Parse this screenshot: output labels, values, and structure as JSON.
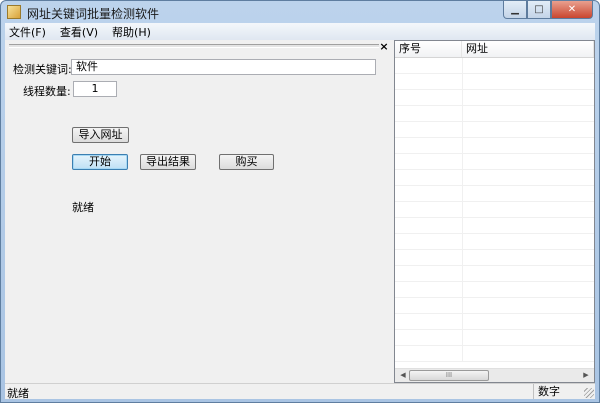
{
  "window": {
    "title": "网址关键词批量检测软件",
    "minimize_glyph": "▁",
    "maximize_glyph": "□",
    "close_glyph": "✕"
  },
  "menu": {
    "items": [
      "文件(F)",
      "查看(V)",
      "帮助(H)"
    ]
  },
  "panel": {
    "close_glyph": "×"
  },
  "form": {
    "keyword_label": "检测关键词:",
    "keyword_value": "软件",
    "threads_label": "线程数量:",
    "threads_value": "1",
    "import_button": "导入网址",
    "start_button": "开始",
    "export_button": "导出结果",
    "buy_button": "购买",
    "status_text": "就绪"
  },
  "list": {
    "columns": [
      "序号",
      "网址"
    ],
    "scroll_thumb_glyph": "III"
  },
  "statusbar": {
    "left": "就绪",
    "right": "数字"
  },
  "colors": {
    "title_gradient_top": "#bcd3ec",
    "close_button": "#c9462f",
    "default_button_border": "#3c7fb1"
  }
}
